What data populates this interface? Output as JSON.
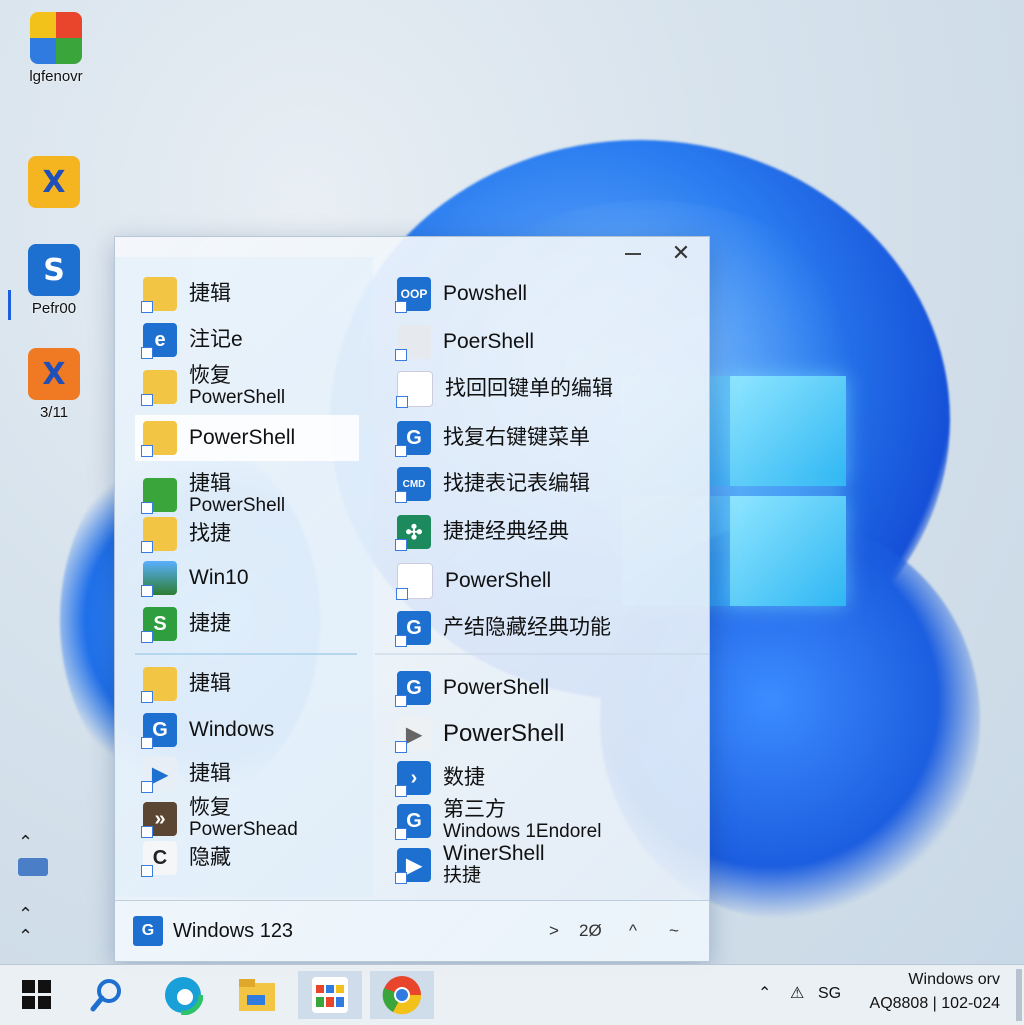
{
  "desktop": {
    "icons": [
      {
        "label": "lgfenovr",
        "icon": "windows-xp-logo-icon"
      },
      {
        "label": "",
        "icon": "x-app-icon"
      },
      {
        "label": "Pefr00",
        "icon": "swirl-app-icon"
      },
      {
        "label": "3/11",
        "icon": "x-app-red-icon"
      }
    ]
  },
  "menu": {
    "left_items": [
      {
        "label": "捷辑",
        "icon": "folder-icon"
      },
      {
        "label": "注记e",
        "icon": "edge-icon"
      },
      {
        "label": "恢复",
        "sub": "PowerShell",
        "icon": "folder-icon"
      },
      {
        "label": "PowerShell",
        "icon": "folder-icon",
        "selected": true
      },
      {
        "label": "捷辑",
        "sub": "PowerShell",
        "icon": "globe-icon"
      },
      {
        "label": "找捷",
        "icon": "folder-icon"
      },
      {
        "label": "Win10",
        "icon": "landscape-icon"
      },
      {
        "label": "捷捷",
        "icon": "green-swirl-icon"
      },
      {
        "label": "捷辑",
        "icon": "folder-icon"
      },
      {
        "label": "Windows",
        "icon": "g-app-icon"
      },
      {
        "label": "捷辑",
        "icon": "play-icon"
      },
      {
        "label": "恢复",
        "sub": "PowerShead",
        "icon": "media-icon"
      },
      {
        "label": "隐藏",
        "icon": "c-app-icon"
      }
    ],
    "right_items": [
      {
        "label": "Powshell",
        "icon": "oop-app-icon"
      },
      {
        "label": "PoerShell",
        "icon": "blank-file-icon"
      },
      {
        "label": "找回回键单的编辑",
        "icon": "document-icon"
      },
      {
        "label": "找复右键键菜单",
        "icon": "g-app-icon"
      },
      {
        "label": "找捷表记表编辑",
        "icon": "cmd-app-icon"
      },
      {
        "label": "捷捷经典经典",
        "icon": "puzzle-icon"
      },
      {
        "label": "PowerShell",
        "icon": "document-icon"
      },
      {
        "label": "产结隐藏经典功能",
        "icon": "g-app-icon"
      },
      {
        "label": "PowerShell",
        "icon": "g-app-icon"
      },
      {
        "label": "PowerShell",
        "icon": "play-icon"
      },
      {
        "label": "数捷",
        "icon": "play-icon"
      },
      {
        "label": "第三方",
        "sub": "Windows 1Endorel",
        "icon": "g-app-icon"
      },
      {
        "label": "WinerShell",
        "sub": "扶捷",
        "icon": "play-icon"
      }
    ],
    "footer": {
      "label": "Windows 123",
      "controls": [
        ">",
        "2Ø",
        "^",
        "~"
      ]
    }
  },
  "taskbar": {
    "apps": [
      "start-icon",
      "search-icon",
      "edge-icon",
      "file-explorer-icon",
      "store-icon",
      "chrome-icon"
    ],
    "tray": {
      "line1": "Windows orv",
      "line2": "AQ8808 | 102-024",
      "lang": "SG"
    }
  },
  "colors": {
    "accent": "#1d6fd0",
    "wallpaper": "#2a7cf0"
  }
}
